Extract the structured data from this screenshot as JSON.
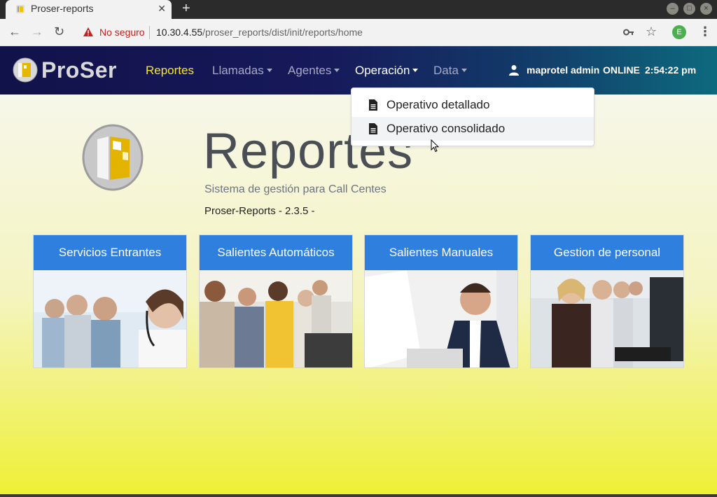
{
  "browser": {
    "tab_title": "Proser-reports",
    "tab_close": "✕",
    "new_tab": "+",
    "security_label": "No seguro",
    "url_host": "10.30.4.55",
    "url_path": "/proser_reports/dist/init/reports/home",
    "profile_initial": "E"
  },
  "navbar": {
    "brand": "ProSer",
    "items": [
      {
        "label": "Reportes",
        "state": "active",
        "dropdown": false
      },
      {
        "label": "Llamadas",
        "state": "normal",
        "dropdown": true
      },
      {
        "label": "Agentes",
        "state": "normal",
        "dropdown": true
      },
      {
        "label": "Operación",
        "state": "open",
        "dropdown": true
      },
      {
        "label": "Data",
        "state": "normal",
        "dropdown": true
      }
    ],
    "user": "maprotel admin",
    "status": "ONLINE",
    "time": "2:54:22 pm"
  },
  "dropdown": {
    "items": [
      {
        "label": "Operativo detallado",
        "icon": "file-icon"
      },
      {
        "label": "Operativo consolidado",
        "icon": "file-icon",
        "hovered": true
      }
    ]
  },
  "hero": {
    "title": "Reportes",
    "subtitle": "Sistema de gestión para Call Centes",
    "version": "Proser-Reports - 2.3.5 -"
  },
  "cards": [
    {
      "title": "Servicios Entrantes",
      "image": "call-center-agents-photo"
    },
    {
      "title": "Salientes Automáticos",
      "image": "call-center-team-photo"
    },
    {
      "title": "Salientes Manuales",
      "image": "agent-with-headset-photo"
    },
    {
      "title": "Gestion de personal",
      "image": "office-agents-photo"
    }
  ],
  "colors": {
    "nav_active": "#f5e52c",
    "card_header": "#2f7fdf",
    "insecure_red": "#c5221f"
  }
}
